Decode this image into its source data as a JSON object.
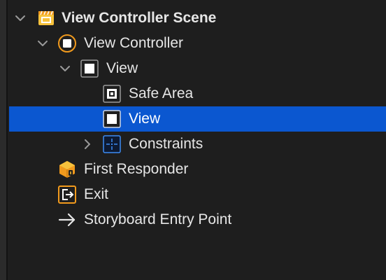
{
  "colors": {
    "background": "#1e1e1e",
    "selection": "#0b57d0",
    "orange_icon": "#f19a1d",
    "blue_icon": "#3d8cf5",
    "text": "#e6e6e6"
  },
  "outline": {
    "scene": {
      "label": "View Controller Scene",
      "icon": "storyboard-scene-icon",
      "expanded": true
    },
    "view_controller": {
      "label": "View Controller",
      "icon": "view-controller-icon",
      "expanded": true
    },
    "view": {
      "label": "View",
      "icon": "view-icon",
      "expanded": true
    },
    "safe_area": {
      "label": "Safe Area",
      "icon": "safe-area-icon"
    },
    "child_view": {
      "label": "View",
      "icon": "view-icon",
      "selected": true
    },
    "constraints": {
      "label": "Constraints",
      "icon": "constraints-icon",
      "expanded": false
    },
    "first_responder": {
      "label": "First Responder",
      "icon": "first-responder-icon"
    },
    "exit": {
      "label": "Exit",
      "icon": "exit-icon"
    },
    "entry_point": {
      "label": "Storyboard Entry Point",
      "icon": "entry-point-arrow-icon"
    }
  }
}
